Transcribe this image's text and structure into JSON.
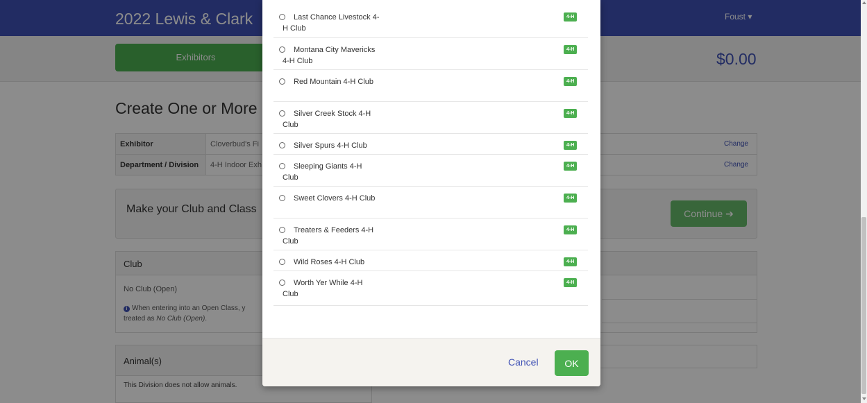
{
  "header": {
    "title": "2022 Lewis & Clark",
    "user_menu": "Foust ▾"
  },
  "subbar": {
    "exhibitors_tab": "Exhibitors",
    "total": "$0.00"
  },
  "page": {
    "title": "Create One or More"
  },
  "info_table": {
    "rows": [
      {
        "label": "Exhibitor",
        "value": "Cloverbud's Fi",
        "action": "Change"
      },
      {
        "label": "Department / Division",
        "value": "4-H Indoor Exh",
        "action": "Change"
      }
    ]
  },
  "continue_panel": {
    "message": "Make your Club and Class",
    "button": "Continue ➔"
  },
  "club_panel": {
    "header": "Club",
    "current": "No Club (Open)",
    "note_prefix": "When entering into an Open Class, y",
    "note_suffix_plain": "treated as ",
    "note_suffix_italic": "No Club (Open)",
    "note_end": "."
  },
  "animal_panel": {
    "header": "Animal(s)",
    "text": "This Division does not allow animals."
  },
  "modal": {
    "clubs": [
      {
        "name": "Last Chance Livestock 4-H Club",
        "badge": "4-H"
      },
      {
        "name": "Montana City Mavericks 4-H Club",
        "badge": "4-H"
      },
      {
        "name": "Red Mountain 4-H Club",
        "badge": "4-H"
      },
      {
        "name": "Silver Creek Stock 4-H Club",
        "badge": "4-H"
      },
      {
        "name": "Silver Spurs 4-H Club",
        "badge": "4-H"
      },
      {
        "name": "Sleeping Giants 4-H Club",
        "badge": "4-H"
      },
      {
        "name": "Sweet Clovers 4-H Club",
        "badge": "4-H"
      },
      {
        "name": "Treaters & Feeders 4-H Club",
        "badge": "4-H"
      },
      {
        "name": "Wild Roses 4-H Club",
        "badge": "4-H"
      },
      {
        "name": "Worth Yer While 4-H Club",
        "badge": "4-H"
      }
    ],
    "cancel_label": "Cancel",
    "ok_label": "OK"
  },
  "colors": {
    "navbar": "#3f51b5",
    "accent_green": "#4caf50",
    "link_blue": "#3f51b5"
  }
}
